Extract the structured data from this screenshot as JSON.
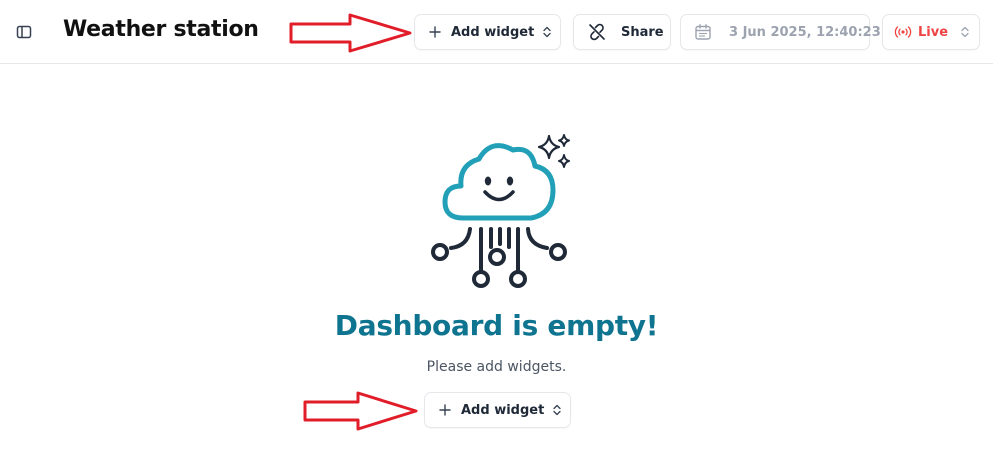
{
  "header": {
    "title": "Weather station",
    "add_widget_label": "Add widget",
    "share_label": "Share",
    "datetime": "3 Jun 2025, 12:40:23",
    "live_label": "Live"
  },
  "empty_state": {
    "title": "Dashboard is empty!",
    "subtitle": "Please add widgets.",
    "add_widget_label": "Add widget"
  },
  "colors": {
    "accent": "#0e7490",
    "cloud_stroke": "#22a0b8",
    "live": "#ef4444",
    "annotation_arrow": "#e11d2a"
  },
  "icons": {
    "sidebar_toggle": "sidebar-toggle-icon",
    "add": "plus-icon",
    "chevron": "chevron-up-down-icon",
    "share": "unlink-icon",
    "calendar": "calendar-icon",
    "live": "broadcast-icon",
    "illustration": "cloud-robot-illustration",
    "sparkles": "sparkles-icon",
    "annotation": "annotation-arrow-icon"
  }
}
